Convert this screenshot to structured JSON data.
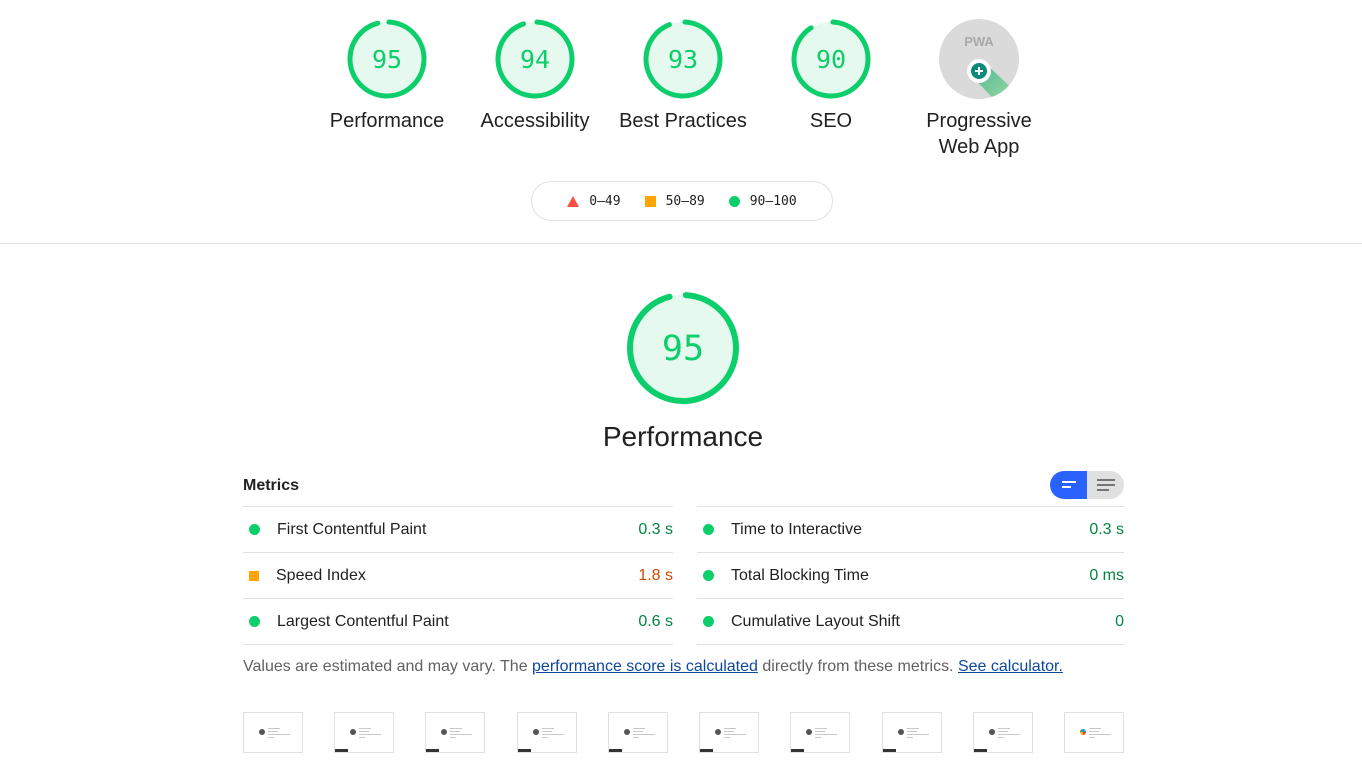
{
  "top_gauges": [
    {
      "id": "performance",
      "label": "Performance",
      "score": 95
    },
    {
      "id": "accessibility",
      "label": "Accessibility",
      "score": 94
    },
    {
      "id": "best-practices",
      "label": "Best Practices",
      "score": 93
    },
    {
      "id": "seo",
      "label": "SEO",
      "score": 90
    },
    {
      "id": "pwa",
      "label_line1": "Progressive",
      "label_line2": "Web App",
      "badge_text": "PWA"
    }
  ],
  "legend": {
    "fail": "0–49",
    "average": "50–89",
    "pass": "90–100"
  },
  "colors": {
    "pass": "#0cce6b",
    "pass_text": "#018642",
    "pass_bg": "#e5f9ee",
    "average": "#ffa400",
    "average_text": "#d04900",
    "fail": "#ff4e42",
    "toggle_active": "#2962ff",
    "link": "#0d47a1"
  },
  "performance": {
    "score": 95,
    "title": "Performance",
    "metrics_title": "Metrics",
    "metrics_left": [
      {
        "name": "First Contentful Paint",
        "value": "0.3 s",
        "rating": "pass"
      },
      {
        "name": "Speed Index",
        "value": "1.8 s",
        "rating": "average"
      },
      {
        "name": "Largest Contentful Paint",
        "value": "0.6 s",
        "rating": "pass"
      }
    ],
    "metrics_right": [
      {
        "name": "Time to Interactive",
        "value": "0.3 s",
        "rating": "pass"
      },
      {
        "name": "Total Blocking Time",
        "value": "0 ms",
        "rating": "pass"
      },
      {
        "name": "Cumulative Layout Shift",
        "value": "0",
        "rating": "pass"
      }
    ],
    "note_prefix": "Values are estimated and may vary. The ",
    "note_link1": "performance score is calculated",
    "note_middle": " directly from these metrics. ",
    "note_link2": "See calculator.",
    "toggle": {
      "compact_view": "active",
      "expanded_view": "inactive"
    }
  },
  "filmstrip": {
    "frame_count": 10
  }
}
